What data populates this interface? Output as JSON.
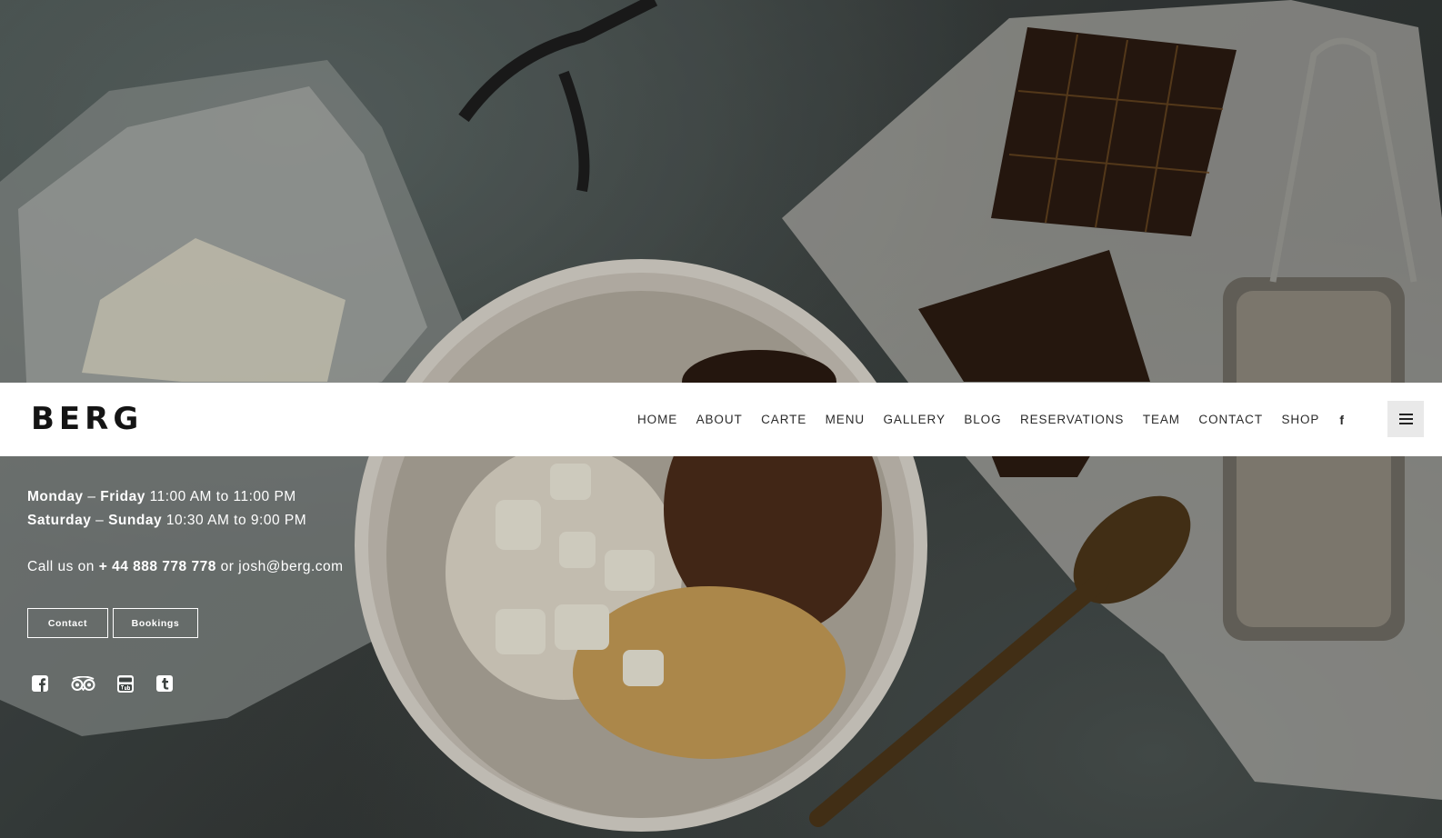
{
  "brand": {
    "logo_text": "BERG"
  },
  "nav": {
    "items": [
      "HOME",
      "ABOUT",
      "CARTE",
      "MENU",
      "GALLERY",
      "BLOG",
      "RESERVATIONS",
      "TEAM",
      "CONTACT",
      "SHOP"
    ],
    "facebook_glyph": "f",
    "menu_icon": "hamburger-icon"
  },
  "hours": [
    {
      "days_start": "Monday",
      "sep": " – ",
      "days_end": "Friday",
      "times": "11:00 AM to 11:00 PM"
    },
    {
      "days_start": "Saturday",
      "sep": " – ",
      "days_end": "Sunday",
      "times": "10:30 AM to 9:00 PM"
    }
  ],
  "contact_line": {
    "prefix": "Call us on ",
    "phone": "+ 44 888 778 778",
    "middle": " or ",
    "email": "josh@berg.com"
  },
  "buttons": {
    "contact": "Contact",
    "bookings": "Bookings"
  },
  "socials": [
    "facebook-icon",
    "tripadvisor-icon",
    "youtube-icon",
    "tumblr-icon"
  ],
  "colors": {
    "header_bg": "#ffffff",
    "text_light": "#ffffff",
    "nav_text": "#2b2b2b"
  }
}
